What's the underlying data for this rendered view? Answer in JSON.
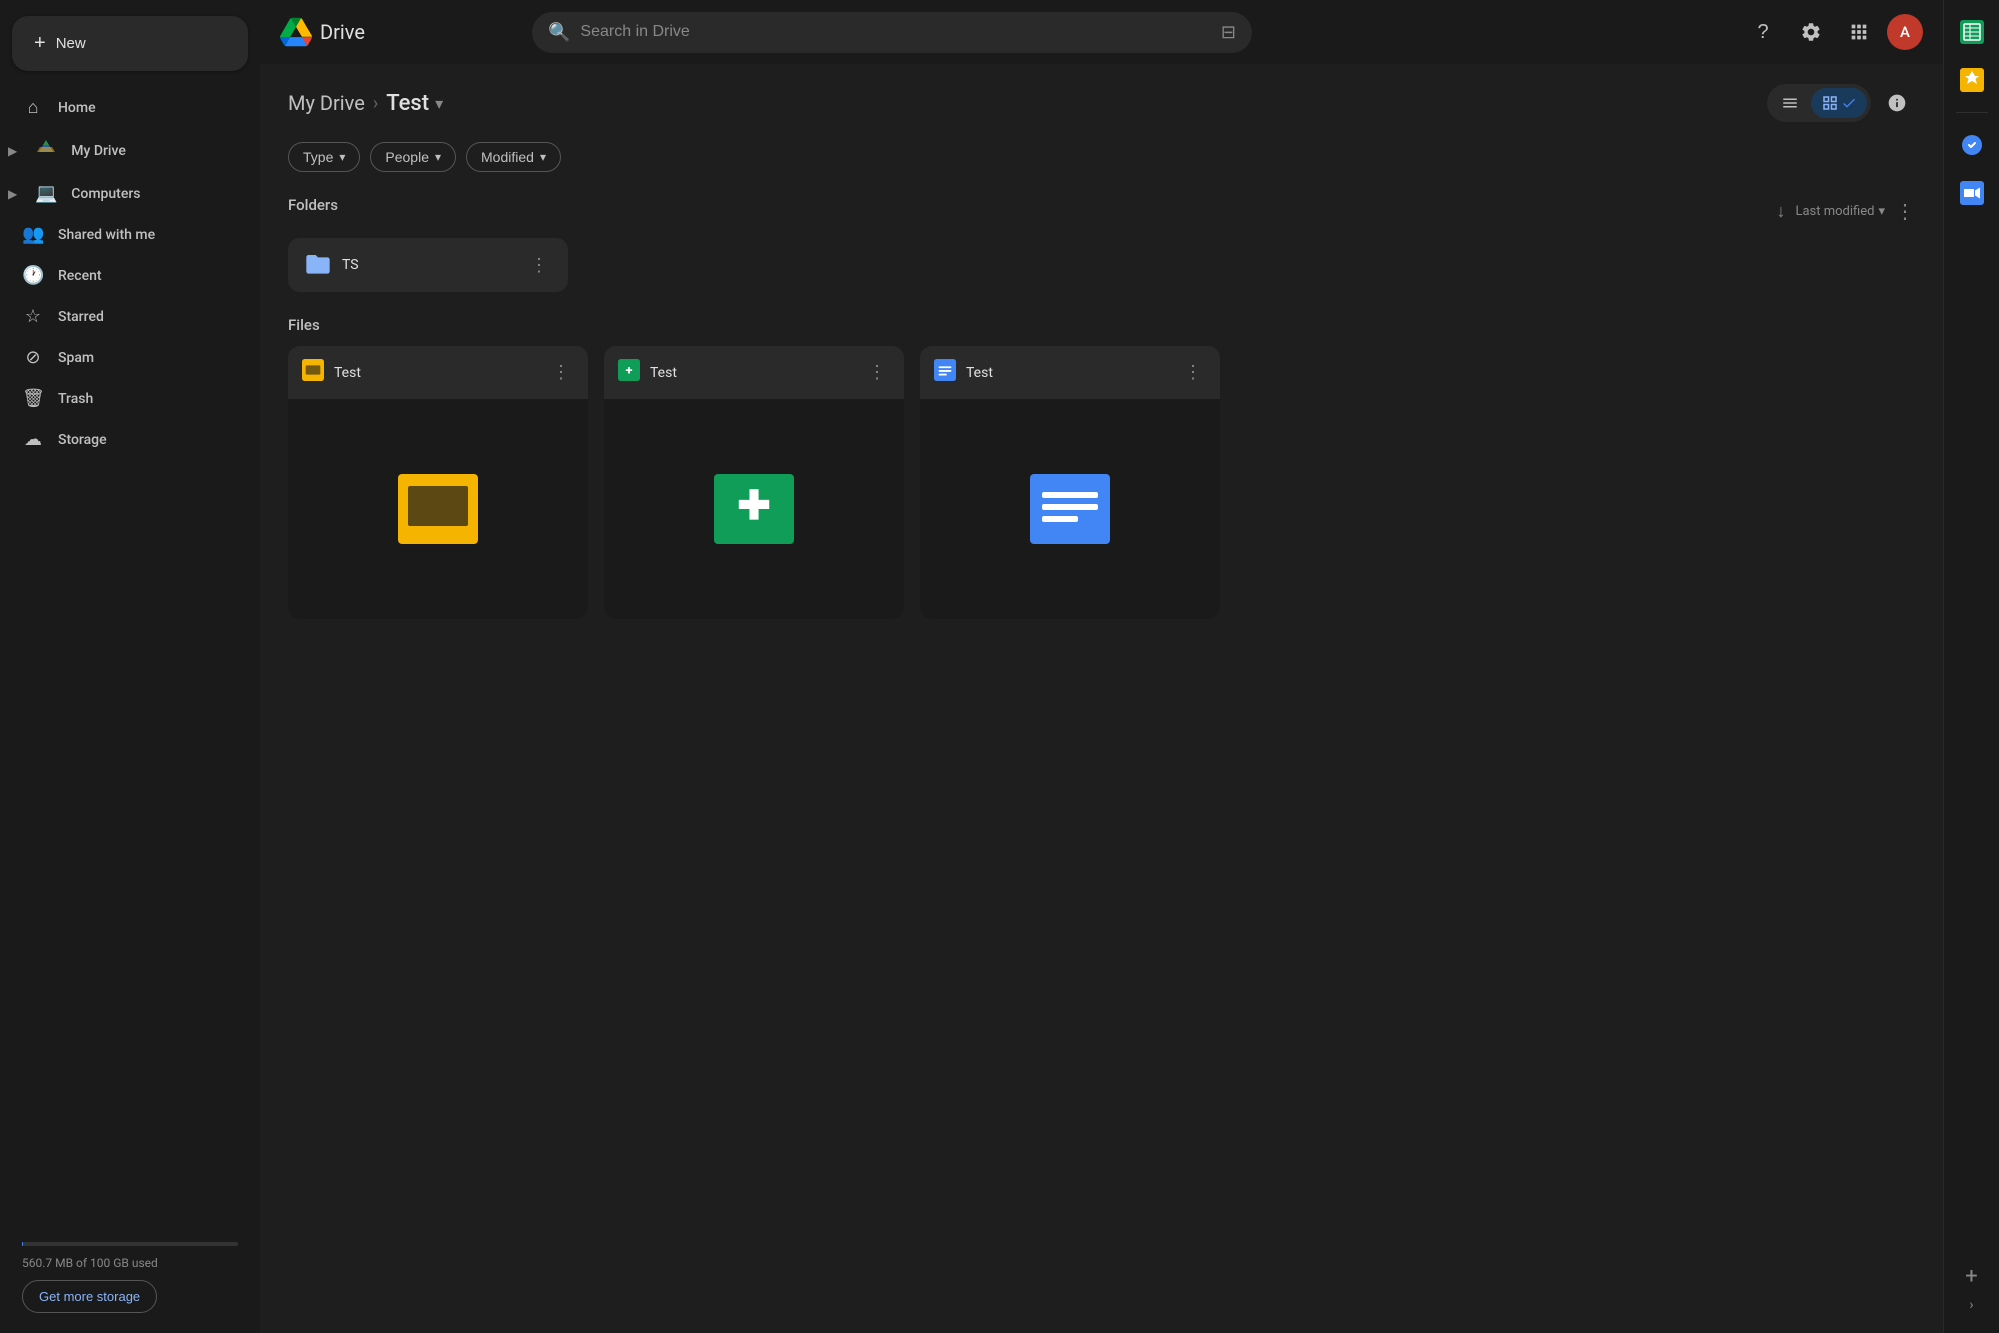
{
  "app": {
    "name": "Drive",
    "logo_alt": "Google Drive"
  },
  "topbar": {
    "search_placeholder": "Search in Drive",
    "help_label": "?",
    "settings_label": "⚙",
    "apps_label": "⋮⋮⋮",
    "avatar_initials": "A"
  },
  "sidebar": {
    "new_button": "New",
    "nav_items": [
      {
        "id": "home",
        "icon": "⌂",
        "label": "Home"
      },
      {
        "id": "my-drive",
        "icon": "△",
        "label": "My Drive",
        "has_arrow": true
      },
      {
        "id": "computers",
        "icon": "▭",
        "label": "Computers",
        "has_arrow": true
      },
      {
        "id": "shared",
        "icon": "👤",
        "label": "Shared with me"
      },
      {
        "id": "recent",
        "icon": "🕐",
        "label": "Recent"
      },
      {
        "id": "starred",
        "icon": "☆",
        "label": "Starred"
      },
      {
        "id": "spam",
        "icon": "⊘",
        "label": "Spam"
      },
      {
        "id": "trash",
        "icon": "🗑",
        "label": "Trash"
      },
      {
        "id": "storage",
        "icon": "☁",
        "label": "Storage"
      }
    ],
    "storage_text": "560.7 MB of 100 GB used",
    "storage_pct": 0.56,
    "get_more_label": "Get more storage"
  },
  "breadcrumb": {
    "parent": "My Drive",
    "current": "Test",
    "chevron": "▾"
  },
  "toolbar": {
    "list_view_label": "≡",
    "grid_view_label": "⊞",
    "info_label": "ℹ"
  },
  "filters": [
    {
      "id": "type",
      "label": "Type",
      "chevron": "▾"
    },
    {
      "id": "people",
      "label": "People",
      "chevron": "▾"
    },
    {
      "id": "modified",
      "label": "Modified",
      "chevron": "▾"
    }
  ],
  "folders_section": {
    "heading": "Folders",
    "sort_icon": "↓",
    "sort_label": "Last modified",
    "sort_chevron": "▾",
    "items": [
      {
        "id": "ts-folder",
        "name": "TS"
      }
    ]
  },
  "files_section": {
    "heading": "Files",
    "items": [
      {
        "id": "file-slides",
        "name": "Test",
        "type": "slides",
        "icon_color": "#F4B400",
        "icon_bg": "#F4B400",
        "icon_symbol": "▬"
      },
      {
        "id": "file-forms",
        "name": "Test",
        "type": "forms",
        "icon_color": "#0F9D58",
        "icon_bg": "#0F9D58",
        "icon_symbol": "✚"
      },
      {
        "id": "file-docs",
        "name": "Test",
        "type": "docs",
        "icon_color": "#4285F4",
        "icon_bg": "#4285F4",
        "icon_symbol": "≡"
      }
    ]
  },
  "right_panel": {
    "icons": [
      {
        "id": "sheets",
        "symbol": "▦",
        "color": "#0F9D58"
      },
      {
        "id": "keep",
        "symbol": "◈",
        "color": "#F4B400"
      },
      {
        "id": "tasks",
        "symbol": "✓",
        "color": "#4285F4"
      },
      {
        "id": "meet",
        "symbol": "🎥",
        "color": "#4285F4"
      }
    ],
    "add_symbol": "+",
    "chevron_symbol": "›"
  },
  "colors": {
    "accent_blue": "#4285F4",
    "accent_green": "#0F9D58",
    "accent_yellow": "#F4B400",
    "accent_red": "#EA4335",
    "bg_dark": "#1a1a1a",
    "bg_card": "#2a2a2a",
    "text_primary": "#e0e0e0",
    "text_secondary": "#888"
  }
}
